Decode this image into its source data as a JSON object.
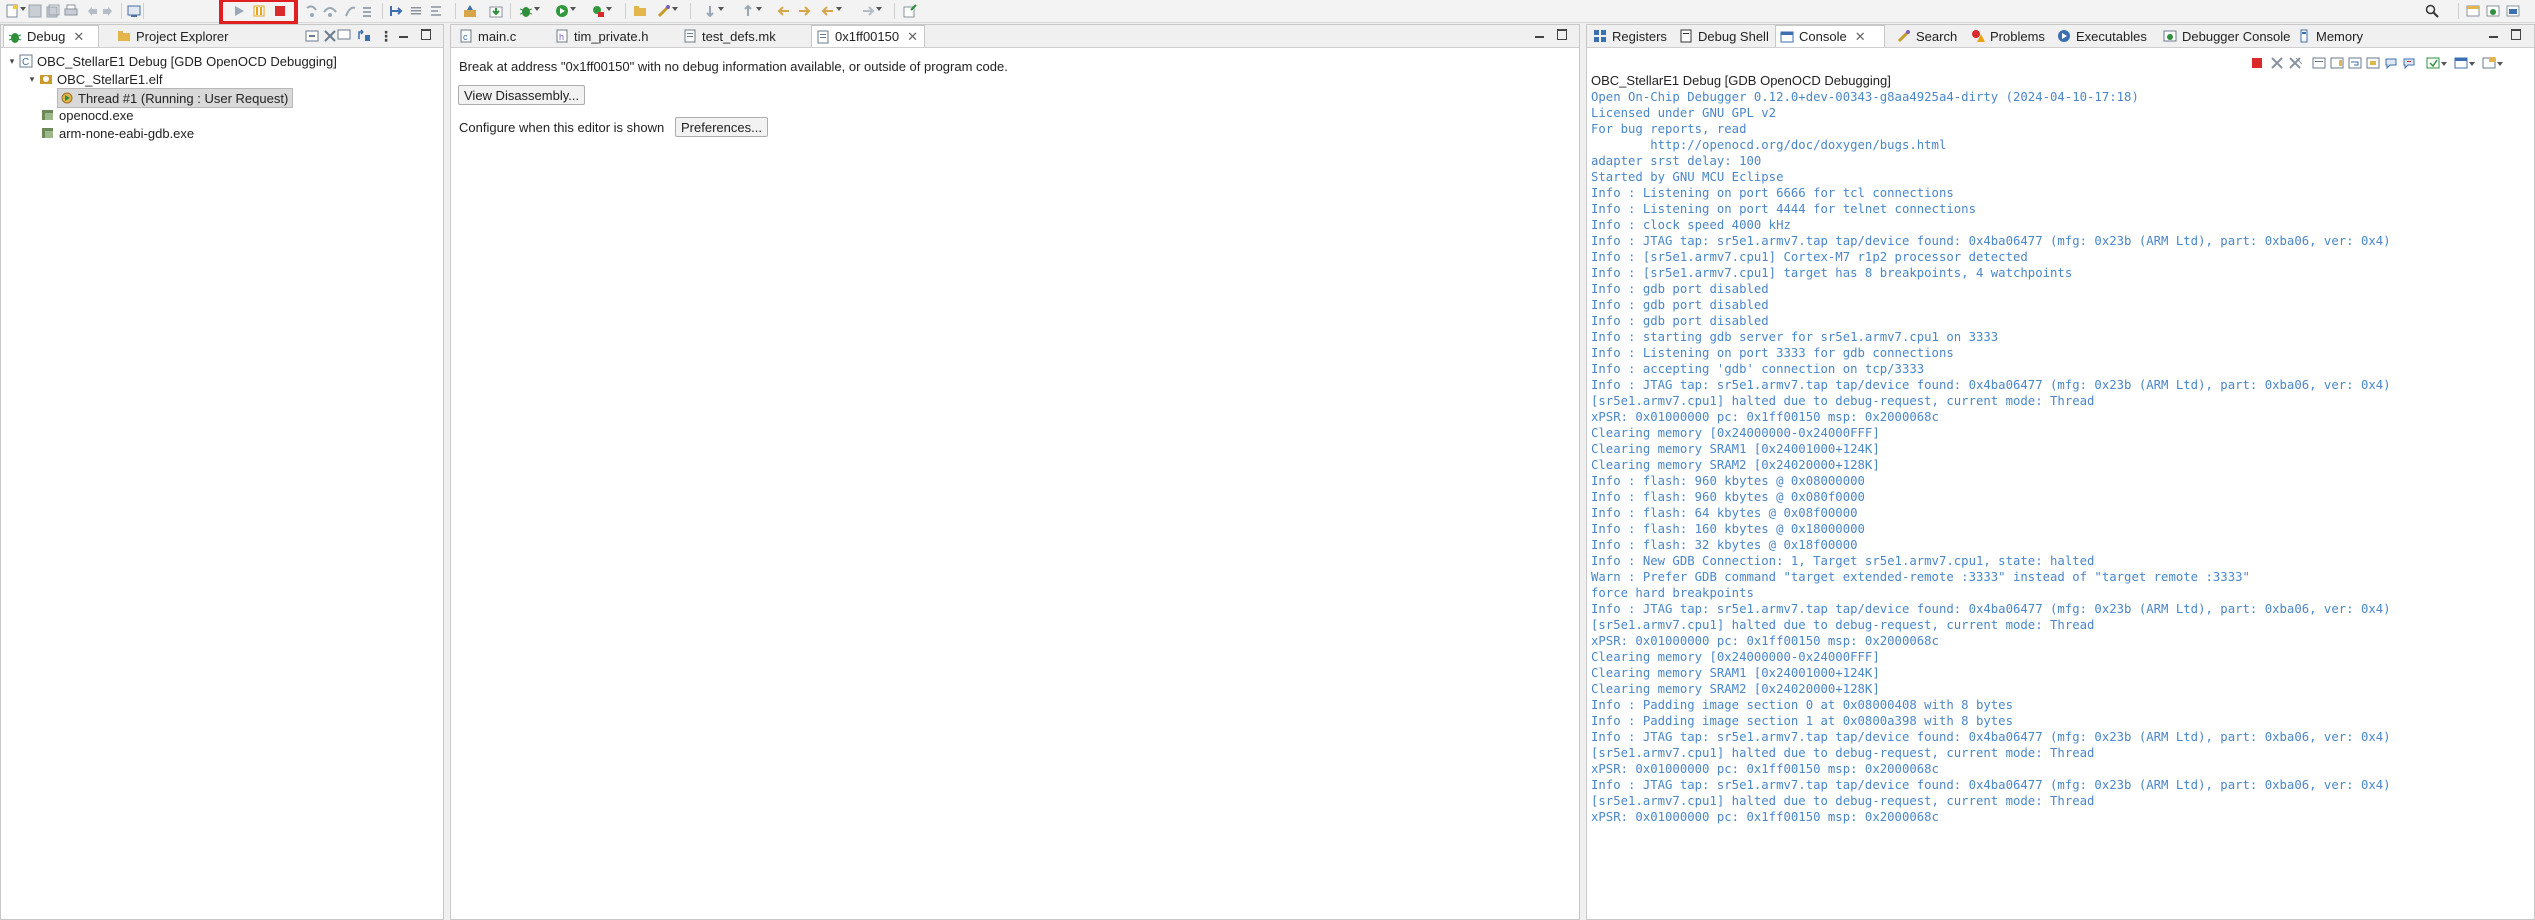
{
  "toolbar": {
    "icons": [
      "new-icon",
      "save-icon",
      "save-all-icon",
      "print-icon",
      "undo-icon",
      "redo-icon",
      "debug-view-icon",
      "resume-icon",
      "suspend-icon",
      "terminate-icon",
      "step-into-icon",
      "step-over-icon",
      "step-return-icon",
      "instruction-step-icon",
      "debug-icon",
      "run-icon",
      "external-tools-icon",
      "open-type-icon",
      "search-icon",
      "back-icon",
      "forward-icon"
    ],
    "colors": {
      "highlight": "#e02020",
      "resume": "#9aa8b6",
      "suspend": "#e8a317",
      "terminate": "#d92b2b"
    }
  },
  "debug_panel": {
    "tabs": [
      {
        "label": "Debug",
        "active": true
      },
      {
        "label": "Project Explorer",
        "active": false
      }
    ],
    "tree": [
      {
        "label": "OBC_StellarE1 Debug [GDB OpenOCD Debugging]",
        "level": 0,
        "icon": "launch-config-icon",
        "expanded": true
      },
      {
        "label": "OBC_StellarE1.elf",
        "level": 1,
        "icon": "elf-process-icon",
        "expanded": true
      },
      {
        "label": "Thread #1 (Running : User Request)",
        "level": 2,
        "icon": "running-thread-icon",
        "selected": true
      },
      {
        "label": "openocd.exe",
        "level": 1,
        "icon": "process-icon"
      },
      {
        "label": "arm-none-eabi-gdb.exe",
        "level": 1,
        "icon": "process-icon"
      }
    ]
  },
  "editor": {
    "tabs": [
      {
        "label": "main.c",
        "active": false
      },
      {
        "label": "tim_private.h",
        "active": false
      },
      {
        "label": "test_defs.mk",
        "active": false
      },
      {
        "label": "0x1ff00150",
        "active": true
      }
    ],
    "message": "Break at address \"0x1ff00150\" with no debug information available, or outside of program code.",
    "view_disassembly_label": "View Disassembly...",
    "configure_label": "Configure when this editor is shown",
    "preferences_label": "Preferences..."
  },
  "console_panel": {
    "tabs": [
      {
        "label": "Registers",
        "active": false
      },
      {
        "label": "Debug Shell",
        "active": false
      },
      {
        "label": "Console",
        "active": true
      },
      {
        "label": "Search",
        "active": false
      },
      {
        "label": "Problems",
        "active": false
      },
      {
        "label": "Executables",
        "active": false
      },
      {
        "label": "Debugger Console",
        "active": false
      },
      {
        "label": "Memory",
        "active": false
      }
    ],
    "title": "OBC_StellarE1 Debug [GDB OpenOCD Debugging]",
    "text_color": "#4a86c8",
    "lines": [
      "Open On-Chip Debugger 0.12.0+dev-00343-g8aa4925a4-dirty (2024-04-10-17:18)",
      "Licensed under GNU GPL v2",
      "For bug reports, read",
      "        http://openocd.org/doc/doxygen/bugs.html",
      "adapter srst delay: 100",
      "Started by GNU MCU Eclipse",
      "Info : Listening on port 6666 for tcl connections",
      "Info : Listening on port 4444 for telnet connections",
      "Info : clock speed 4000 kHz",
      "Info : JTAG tap: sr5e1.armv7.tap tap/device found: 0x4ba06477 (mfg: 0x23b (ARM Ltd), part: 0xba06, ver: 0x4)",
      "Info : [sr5e1.armv7.cpu1] Cortex-M7 r1p2 processor detected",
      "Info : [sr5e1.armv7.cpu1] target has 8 breakpoints, 4 watchpoints",
      "Info : gdb port disabled",
      "Info : gdb port disabled",
      "Info : gdb port disabled",
      "Info : starting gdb server for sr5e1.armv7.cpu1 on 3333",
      "Info : Listening on port 3333 for gdb connections",
      "Info : accepting 'gdb' connection on tcp/3333",
      "Info : JTAG tap: sr5e1.armv7.tap tap/device found: 0x4ba06477 (mfg: 0x23b (ARM Ltd), part: 0xba06, ver: 0x4)",
      "[sr5e1.armv7.cpu1] halted due to debug-request, current mode: Thread",
      "xPSR: 0x01000000 pc: 0x1ff00150 msp: 0x2000068c",
      "Clearing memory [0x24000000-0x24000FFF]",
      "Clearing memory SRAM1 [0x24001000+124K]",
      "Clearing memory SRAM2 [0x24020000+128K]",
      "Info : flash: 960 kbytes @ 0x08000000",
      "Info : flash: 960 kbytes @ 0x080f0000",
      "Info : flash: 64 kbytes @ 0x08f00000",
      "Info : flash: 160 kbytes @ 0x18000000",
      "Info : flash: 32 kbytes @ 0x18f00000",
      "Info : New GDB Connection: 1, Target sr5e1.armv7.cpu1, state: halted",
      "Warn : Prefer GDB command \"target extended-remote :3333\" instead of \"target remote :3333\"",
      "force hard breakpoints",
      "Info : JTAG tap: sr5e1.armv7.tap tap/device found: 0x4ba06477 (mfg: 0x23b (ARM Ltd), part: 0xba06, ver: 0x4)",
      "[sr5e1.armv7.cpu1] halted due to debug-request, current mode: Thread",
      "xPSR: 0x01000000 pc: 0x1ff00150 msp: 0x2000068c",
      "Clearing memory [0x24000000-0x24000FFF]",
      "Clearing memory SRAM1 [0x24001000+124K]",
      "Clearing memory SRAM2 [0x24020000+128K]",
      "Info : Padding image section 0 at 0x08000408 with 8 bytes",
      "Info : Padding image section 1 at 0x0800a398 with 8 bytes",
      "Info : JTAG tap: sr5e1.armv7.tap tap/device found: 0x4ba06477 (mfg: 0x23b (ARM Ltd), part: 0xba06, ver: 0x4)",
      "[sr5e1.armv7.cpu1] halted due to debug-request, current mode: Thread",
      "xPSR: 0x01000000 pc: 0x1ff00150 msp: 0x2000068c",
      "Info : JTAG tap: sr5e1.armv7.tap tap/device found: 0x4ba06477 (mfg: 0x23b (ARM Ltd), part: 0xba06, ver: 0x4)",
      "[sr5e1.armv7.cpu1] halted due to debug-request, current mode: Thread",
      "xPSR: 0x01000000 pc: 0x1ff00150 msp: 0x2000068c"
    ]
  }
}
